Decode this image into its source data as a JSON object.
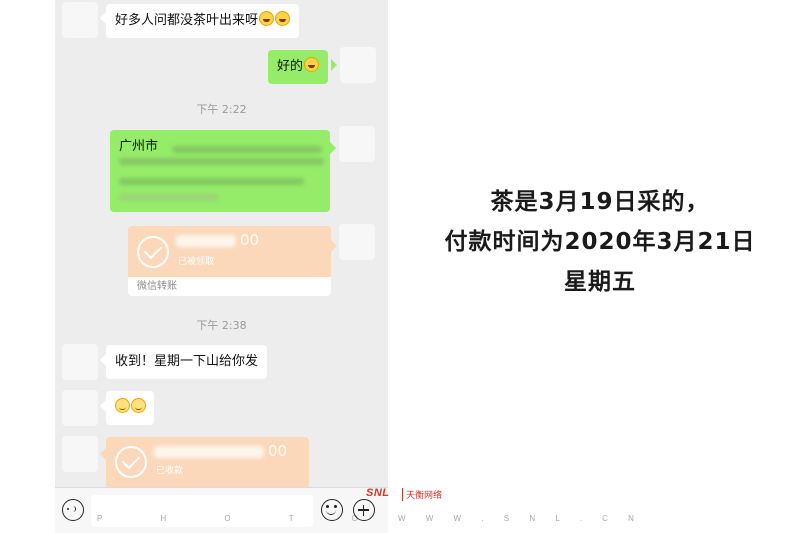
{
  "chat": {
    "messages": [
      {
        "text": "好多人问都没茶叶出来呀"
      },
      {
        "text": "好的"
      },
      {
        "text": "收到！星期一下山给你发"
      }
    ],
    "timestamps": [
      "下午 2:22",
      "下午 2:38"
    ],
    "address_prefix": "广州市",
    "transfers": [
      {
        "amount_suffix": "00",
        "status": "已被领取",
        "label": "微信转账"
      },
      {
        "amount_suffix": "00",
        "status": "已收款"
      }
    ],
    "input_placeholder": "P H O T O B"
  },
  "caption": {
    "line1": "茶是3月19日采的，",
    "line2": "付款时间为2020年3月21日",
    "line3": "星期五"
  },
  "watermark": {
    "logo": "SNL",
    "name": "天衡网络",
    "url": "W W W . S N L . C N"
  },
  "colors": {
    "chat_bg": "#ededed",
    "outgoing_bubble": "#95ec69",
    "transfer_card": "#fbd8b9",
    "watermark_red": "#d9312b"
  }
}
